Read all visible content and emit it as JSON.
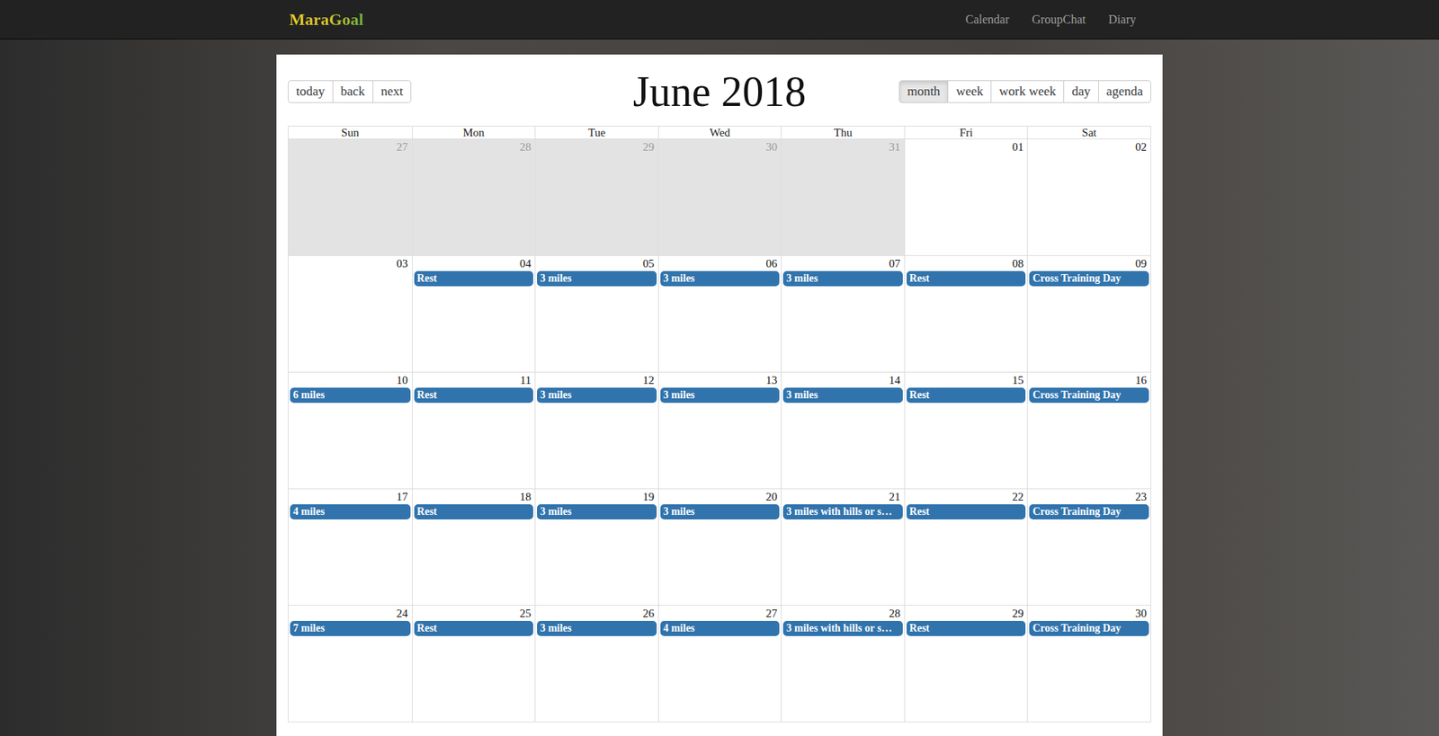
{
  "navbar": {
    "brand": "MaraGoal",
    "links": [
      {
        "label": "Calendar"
      },
      {
        "label": "GroupChat"
      },
      {
        "label": "Diary"
      }
    ]
  },
  "toolbar": {
    "nav_buttons": [
      "today",
      "back",
      "next"
    ],
    "title": "June 2018",
    "views": [
      {
        "label": "month",
        "selected": true
      },
      {
        "label": "week",
        "selected": false
      },
      {
        "label": "work week",
        "selected": false
      },
      {
        "label": "day",
        "selected": false
      },
      {
        "label": "agenda",
        "selected": false
      }
    ]
  },
  "weekdays": [
    "Sun",
    "Mon",
    "Tue",
    "Wed",
    "Thu",
    "Fri",
    "Sat"
  ],
  "weeks": [
    [
      {
        "date": "27",
        "off_range": true,
        "events": []
      },
      {
        "date": "28",
        "off_range": true,
        "events": []
      },
      {
        "date": "29",
        "off_range": true,
        "events": []
      },
      {
        "date": "30",
        "off_range": true,
        "events": []
      },
      {
        "date": "31",
        "off_range": true,
        "events": []
      },
      {
        "date": "01",
        "off_range": false,
        "events": []
      },
      {
        "date": "02",
        "off_range": false,
        "events": []
      }
    ],
    [
      {
        "date": "03",
        "off_range": false,
        "events": []
      },
      {
        "date": "04",
        "off_range": false,
        "events": [
          "Rest"
        ]
      },
      {
        "date": "05",
        "off_range": false,
        "events": [
          "3 miles"
        ]
      },
      {
        "date": "06",
        "off_range": false,
        "events": [
          "3 miles"
        ]
      },
      {
        "date": "07",
        "off_range": false,
        "events": [
          "3 miles"
        ]
      },
      {
        "date": "08",
        "off_range": false,
        "events": [
          "Rest"
        ]
      },
      {
        "date": "09",
        "off_range": false,
        "events": [
          "Cross Training Day"
        ]
      }
    ],
    [
      {
        "date": "10",
        "off_range": false,
        "events": [
          "6 miles"
        ]
      },
      {
        "date": "11",
        "off_range": false,
        "events": [
          "Rest"
        ]
      },
      {
        "date": "12",
        "off_range": false,
        "events": [
          "3 miles"
        ]
      },
      {
        "date": "13",
        "off_range": false,
        "events": [
          "3 miles"
        ]
      },
      {
        "date": "14",
        "off_range": false,
        "events": [
          "3 miles"
        ]
      },
      {
        "date": "15",
        "off_range": false,
        "events": [
          "Rest"
        ]
      },
      {
        "date": "16",
        "off_range": false,
        "events": [
          "Cross Training Day"
        ]
      }
    ],
    [
      {
        "date": "17",
        "off_range": false,
        "events": [
          "4 miles"
        ]
      },
      {
        "date": "18",
        "off_range": false,
        "events": [
          "Rest"
        ]
      },
      {
        "date": "19",
        "off_range": false,
        "events": [
          "3 miles"
        ]
      },
      {
        "date": "20",
        "off_range": false,
        "events": [
          "3 miles"
        ]
      },
      {
        "date": "21",
        "off_range": false,
        "events": [
          "3 miles with hills or s…"
        ]
      },
      {
        "date": "22",
        "off_range": false,
        "events": [
          "Rest"
        ]
      },
      {
        "date": "23",
        "off_range": false,
        "events": [
          "Cross Training Day"
        ]
      }
    ],
    [
      {
        "date": "24",
        "off_range": false,
        "events": [
          "7 miles"
        ]
      },
      {
        "date": "25",
        "off_range": false,
        "events": [
          "Rest"
        ]
      },
      {
        "date": "26",
        "off_range": false,
        "events": [
          "3 miles"
        ]
      },
      {
        "date": "27",
        "off_range": false,
        "events": [
          "4 miles"
        ]
      },
      {
        "date": "28",
        "off_range": false,
        "events": [
          "3 miles with hills or s…"
        ]
      },
      {
        "date": "29",
        "off_range": false,
        "events": [
          "Rest"
        ]
      },
      {
        "date": "30",
        "off_range": false,
        "events": [
          "Cross Training Day"
        ]
      }
    ]
  ]
}
